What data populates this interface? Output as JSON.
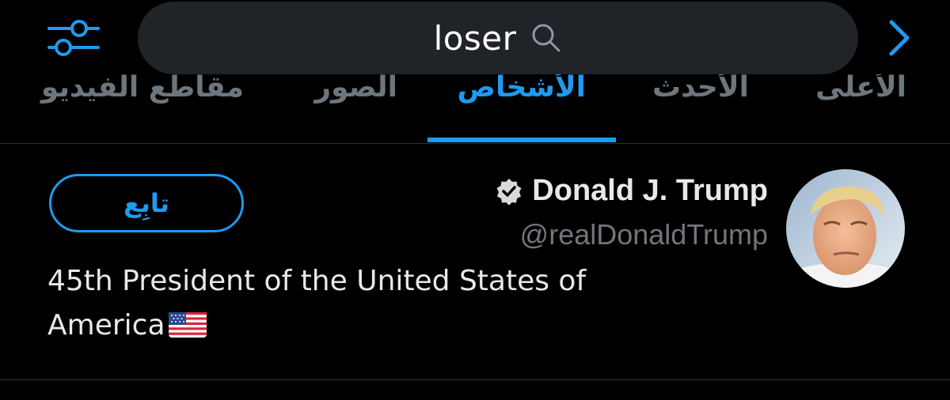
{
  "search": {
    "query": "loser",
    "icon": "search-icon"
  },
  "top_bar": {
    "filter_icon": "sliders-icon",
    "forward_icon": "chevron-right-icon",
    "accent_color": "#1d9bf0"
  },
  "tabs": [
    {
      "label": "الأعلى",
      "active": false
    },
    {
      "label": "الأحدث",
      "active": false
    },
    {
      "label": "الأشخاص",
      "active": true
    },
    {
      "label": "الصور",
      "active": false
    },
    {
      "label": "مقاطع الفيديو",
      "active": false
    }
  ],
  "result": {
    "display_name": "Donald J. Trump",
    "verified": true,
    "verified_icon": "verified-badge-icon",
    "handle": "@realDonaldTrump",
    "follow_label": "تابِع",
    "bio": "45th President of the United States of America",
    "bio_emoji": "us-flag-icon"
  },
  "colors": {
    "background": "#000000",
    "search_field": "#202327",
    "accent": "#1d9bf0",
    "inactive_tab": "#6e767d",
    "secondary_text": "#71767b",
    "divider": "#2f3336"
  }
}
